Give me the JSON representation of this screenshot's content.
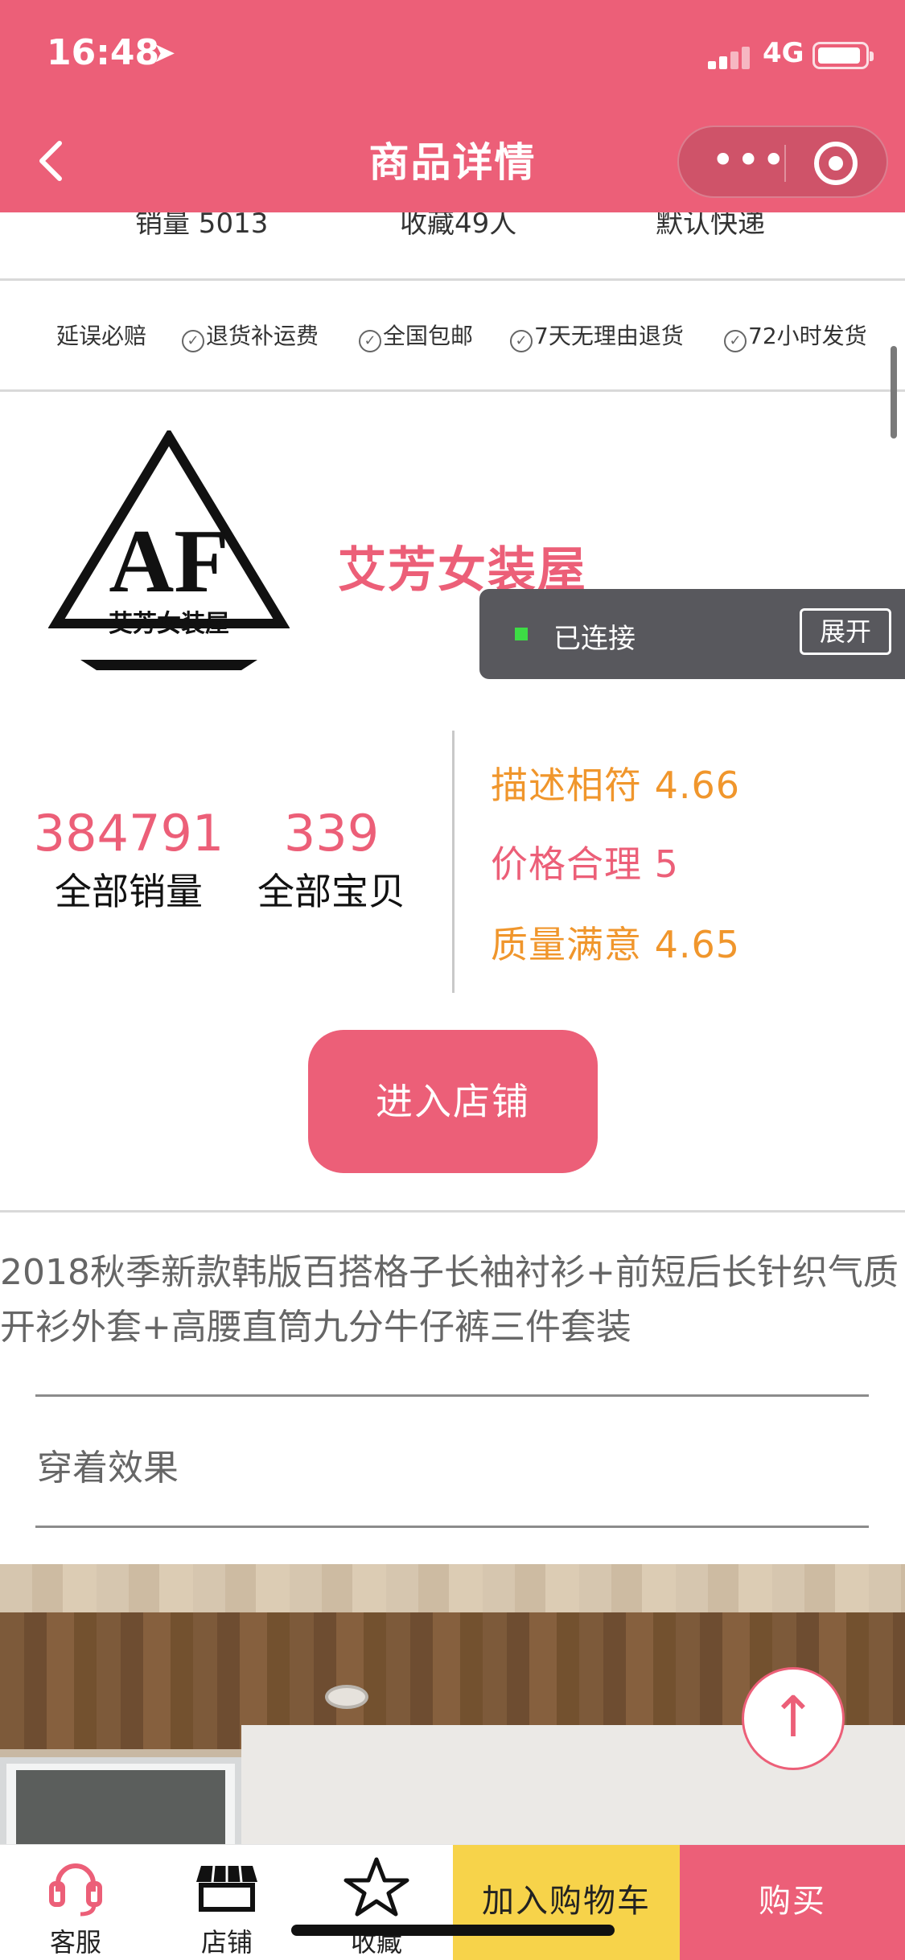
{
  "status_bar": {
    "time": "16:48",
    "network": "4G"
  },
  "nav": {
    "title": "商品详情"
  },
  "stats": {
    "sales": "销量 5013",
    "favorites": "收藏49人",
    "shipping": "默认快递"
  },
  "guarantees": [
    "延误必赔",
    "退货补运费",
    "全国包邮",
    "7天无理由退货",
    "72小时发货"
  ],
  "shop": {
    "logo_text": "AF",
    "logo_subtext": "艾芳女装屋",
    "name": "艾芳女装屋",
    "total_sales_value": "384791",
    "total_sales_label": "全部销量",
    "total_items_value": "339",
    "total_items_label": "全部宝贝",
    "ratings": [
      {
        "label": "描述相符 4.66",
        "color": "#f0962c"
      },
      {
        "label": "价格合理 5",
        "color": "#ec5f78"
      },
      {
        "label": "质量满意 4.65",
        "color": "#f0962c"
      }
    ],
    "enter_button": "进入店铺"
  },
  "toast": {
    "text": "已连接",
    "button": "展开"
  },
  "product": {
    "title": "2018秋季新款韩版百搭格子长袖衬衫+前短后长针织气质开衫外套+高腰直筒九分牛仔裤三件套装",
    "section_title": "穿着效果"
  },
  "bottom_bar": {
    "service": "客服",
    "store": "店铺",
    "favorite": "收藏",
    "add_to_cart": "加入购物车",
    "buy": "购买"
  },
  "colors": {
    "brand": "#ec5f78",
    "cart": "#f7d34a",
    "rating_orange": "#f0962c"
  }
}
